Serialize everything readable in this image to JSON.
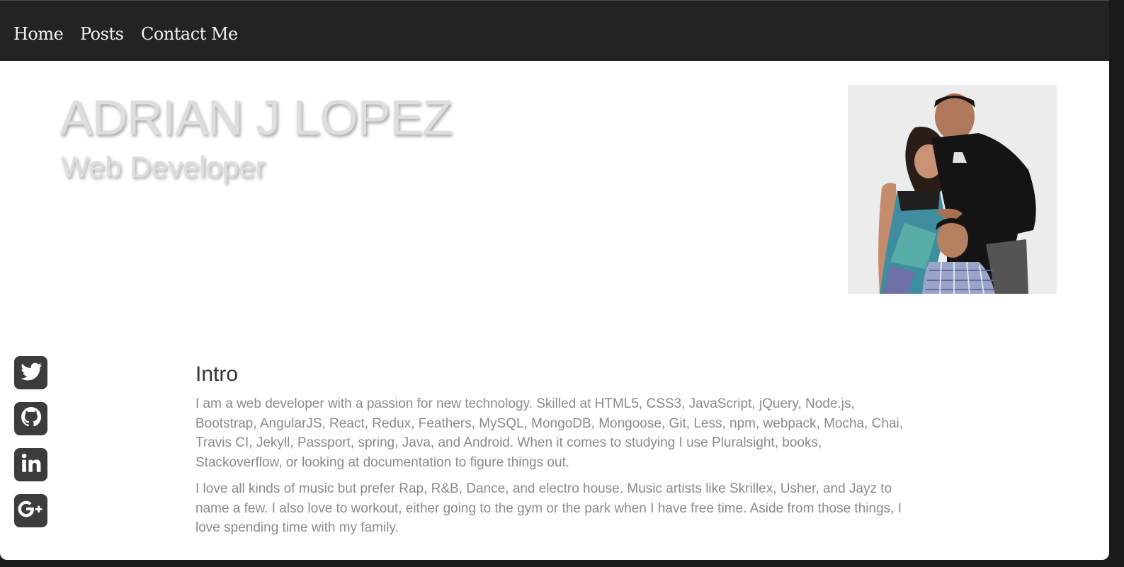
{
  "nav": {
    "items": [
      {
        "label": "Home"
      },
      {
        "label": "Posts"
      },
      {
        "label": "Contact Me"
      }
    ]
  },
  "hero": {
    "name": "ADRIAN J LOPEZ",
    "role": "Web Developer"
  },
  "social": {
    "items": [
      {
        "icon": "twitter-icon"
      },
      {
        "icon": "github-icon"
      },
      {
        "icon": "linkedin-icon"
      },
      {
        "icon": "google-plus-icon"
      }
    ]
  },
  "intro": {
    "title": "Intro",
    "paragraphs": [
      "I am a web developer with a passion for new technology. Skilled at HTML5, CSS3, JavaScript, jQuery, Node.js, Bootstrap, AngularJS, React, Redux, Feathers, MySQL, MongoDB, Mongoose, Git, Less, npm, webpack, Mocha, Chai, Travis CI, Jekyll, Passport, spring, Java, and Android. When it comes to studying I use Pluralsight, books, Stackoverflow, or looking at documentation to figure things out.",
      "I love all kinds of music but prefer Rap, R&B, Dance, and electro house. Music artists like Skrillex, Usher, and Jayz to name a few. I also love to workout, either going to the gym or the park when I have free time. Aside from those things, I love spending time with my family."
    ]
  },
  "colors": {
    "navbar_bg": "#232323",
    "nav_text": "#f2f2f2",
    "hero_text": "#dedede",
    "social_bg": "#3c3c3c",
    "body_text": "#8a8a8a",
    "heading_text": "#333333"
  }
}
